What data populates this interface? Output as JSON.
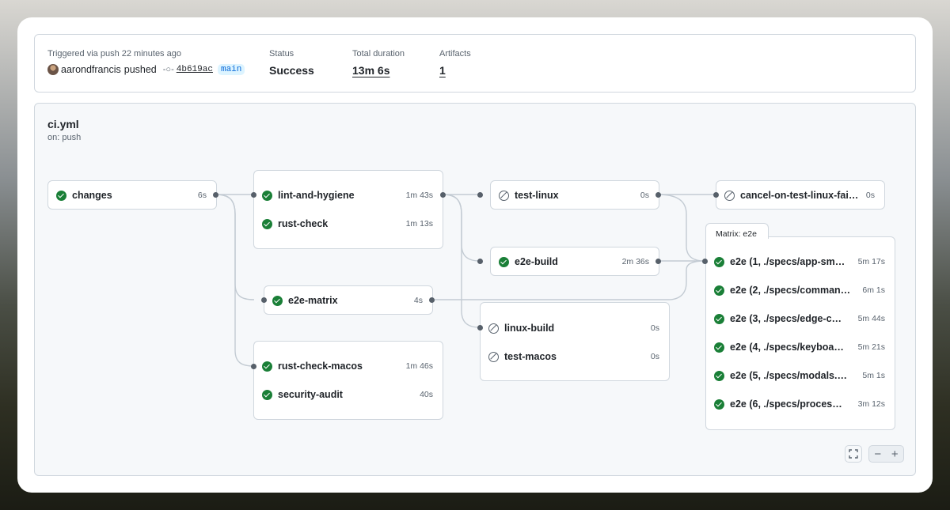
{
  "summary": {
    "trigger_label": "Triggered via push 22 minutes ago",
    "actor": "aarondfrancis",
    "action": "pushed",
    "commit": "4b619ac",
    "branch": "main",
    "status_label": "Status",
    "status_value": "Success",
    "duration_label": "Total duration",
    "duration_value": "13m 6s",
    "artifacts_label": "Artifacts",
    "artifacts_value": "1"
  },
  "workflow": {
    "name": "ci.yml",
    "trigger": "on: push"
  },
  "jobs": {
    "changes": {
      "name": "changes",
      "time": "6s",
      "status": "success"
    },
    "lint": {
      "name": "lint-and-hygiene",
      "time": "1m 43s",
      "status": "success"
    },
    "rust_check": {
      "name": "rust-check",
      "time": "1m 13s",
      "status": "success"
    },
    "e2e_matrix": {
      "name": "e2e-matrix",
      "time": "4s",
      "status": "success"
    },
    "rust_macos": {
      "name": "rust-check-macos",
      "time": "1m 46s",
      "status": "success"
    },
    "security": {
      "name": "security-audit",
      "time": "40s",
      "status": "success"
    },
    "test_linux": {
      "name": "test-linux",
      "time": "0s",
      "status": "skipped"
    },
    "e2e_build": {
      "name": "e2e-build",
      "time": "2m 36s",
      "status": "success"
    },
    "linux_build": {
      "name": "linux-build",
      "time": "0s",
      "status": "skipped"
    },
    "test_macos": {
      "name": "test-macos",
      "time": "0s",
      "status": "skipped"
    },
    "cancel": {
      "name": "cancel-on-test-linux-failure",
      "time": "0s",
      "status": "skipped"
    }
  },
  "matrix": {
    "label": "Matrix: e2e",
    "items": [
      {
        "name": "e2e (1, ./specs/app-sm…",
        "time": "5m 17s",
        "status": "success"
      },
      {
        "name": "e2e (2, ./specs/comman…",
        "time": "6m 1s",
        "status": "success"
      },
      {
        "name": "e2e (3, ./specs/edge-c…",
        "time": "5m 44s",
        "status": "success"
      },
      {
        "name": "e2e (4, ./specs/keyboa…",
        "time": "5m 21s",
        "status": "success"
      },
      {
        "name": "e2e (5, ./specs/modals.…",
        "time": "5m 1s",
        "status": "success"
      },
      {
        "name": "e2e (6, ./specs/proces…",
        "time": "3m 12s",
        "status": "success"
      }
    ]
  },
  "icons": {
    "success": "check-circle-icon",
    "skipped": "skip-icon",
    "commit": "git-commit-icon",
    "fullscreen": "fullscreen-icon",
    "zoom_out": "zoom-out-icon",
    "zoom_in": "zoom-in-icon"
  },
  "colors": {
    "success": "#1a7f37",
    "skipped": "#59636e",
    "branch_text": "#0969da",
    "branch_bg": "#ddf4ff"
  }
}
